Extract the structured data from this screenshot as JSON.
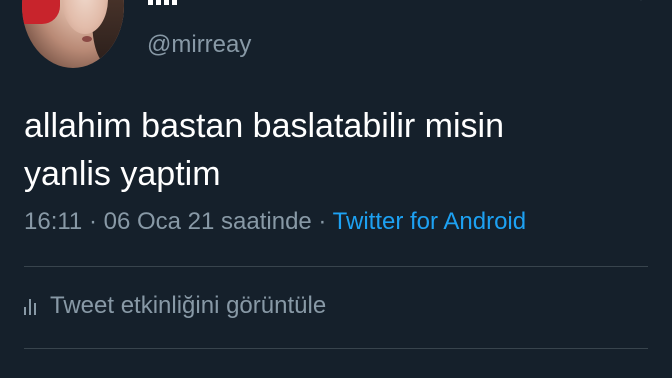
{
  "author": {
    "handle": "@mirreay",
    "avatar_icon": "profile-photo"
  },
  "tweet": {
    "text": "allahim bastan baslatabilir misin\nyanlis yaptim"
  },
  "meta": {
    "time": "16:11",
    "separator1": " · ",
    "date": "06 Oca 21 saatinde",
    "separator2": " · ",
    "source": "Twitter for Android"
  },
  "activity": {
    "icon": "analytics-bars-icon",
    "label": "Tweet etkinliğini görüntüle"
  },
  "colors": {
    "background": "#15202b",
    "text_primary": "#ffffff",
    "text_secondary": "#8899a6",
    "link": "#1da1f2",
    "divider": "#38444d"
  }
}
